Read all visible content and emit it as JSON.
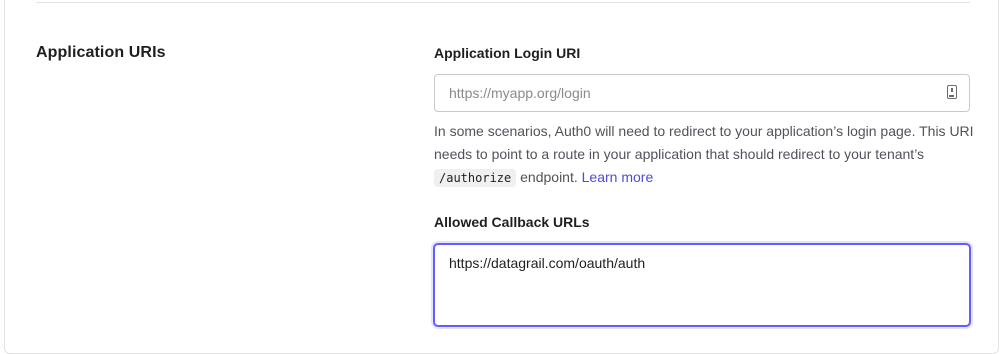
{
  "section": {
    "title": "Application URIs"
  },
  "login_uri": {
    "label": "Application Login URI",
    "placeholder": "https://myapp.org/login",
    "value": "",
    "icon": "clipboard-icon",
    "help": {
      "text_before": "In some scenarios, Auth0 will need to redirect to your application’s login page. This URI needs to point to a route in your application that should redirect to your tenant’s ",
      "code": "/authorize",
      "text_after": " endpoint. ",
      "link": "Learn more"
    }
  },
  "callback_urls": {
    "label": "Allowed Callback URLs",
    "value": "https://datagrail.com/oauth/auth"
  },
  "colors": {
    "accent": "#635dff",
    "link": "#4c4cd9",
    "border": "#c9c9c9"
  }
}
